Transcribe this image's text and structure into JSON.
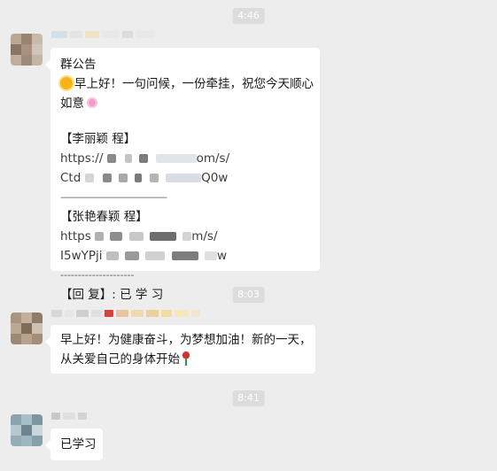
{
  "timestamps": [
    "4:46",
    "8:03",
    "8:41"
  ],
  "messages": {
    "m1": {
      "title": "群公告",
      "greeting": "早上好！一句问候，一份牵挂，祝您今天顺心",
      "greeting_end": "如意",
      "sec1_header": "【李丽颖 程】",
      "sec1_url1_start": "https://",
      "sec1_url1_end": "om/s/",
      "sec1_url2_start": "Ctd",
      "sec1_url2_end": "Q0w",
      "divider1": "————————————",
      "sec2_header": "【张艳春颖 程】",
      "sec2_url1_start": "https",
      "sec2_url1_end": "m/s/",
      "sec2_url2_start": "I5wYPji",
      "sec2_url2_end": "w",
      "divider2": "---------------------",
      "reply": "【回 复】: 已 学 习"
    },
    "m2": {
      "line1": "早上好！为健康奋斗，为梦想加油！新的一天，",
      "line2": "从关爱自己的身体开始"
    },
    "m3": {
      "text": "已学习"
    }
  },
  "icons": [
    "sun-emoji-icon",
    "flower-emoji-icon",
    "rose-emoji-icon"
  ],
  "colors": {
    "background": "#ededed",
    "bubble": "#ffffff",
    "timestamp_pill": "#dcdcdc"
  }
}
